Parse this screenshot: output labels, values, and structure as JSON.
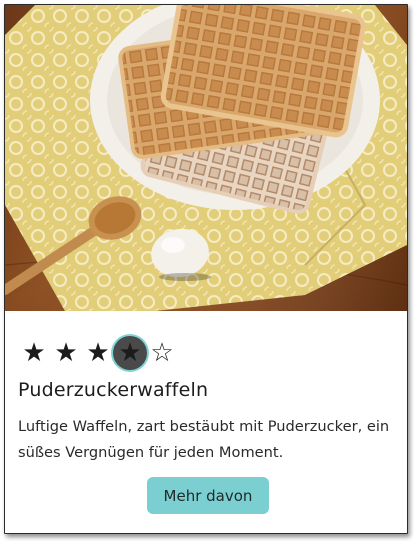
{
  "card": {
    "image_alt": "",
    "rating": {
      "value": 4,
      "max": 5,
      "filled_glyph": "★",
      "empty_glyph": "☆"
    },
    "title": "Puderzuckerwaffeln",
    "description": "Luftige Waffeln, zart bestäubt mit Puderzucker, ein süßes Vergnügen für jeden Moment.",
    "button_label": "Mehr davon"
  },
  "colors": {
    "accent": "#7ccfd1",
    "focus_ring": "#7fd3d3",
    "text": "#1d1d1d"
  }
}
